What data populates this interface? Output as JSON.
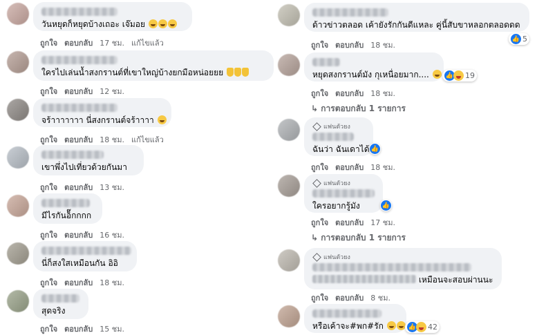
{
  "labels": {
    "like": "ถูกใจ",
    "reply": "ตอบกลับ",
    "edited": "แก้ไขแล้ว",
    "fan_badge": "แฟนตัวยง"
  },
  "left_comments": [
    {
      "text": "วันหยุดก็หยุดบ้างเถอะ เจ๊มอย",
      "time": "17 ชม.",
      "edited": true
    },
    {
      "text": "ใครไปเล่นน้ำสงกรานต์ที่เขาใหญ่บ้างยกมือหน่อยยย",
      "time": "12 ชม.",
      "edited": false
    },
    {
      "text": "จร้าาาาาาา นี่สงกรานต์จร้าาาา",
      "time": "18 ชม.",
      "edited": true
    },
    {
      "text": "เขาพึ่งไปเที่ยวด้วยกันมา",
      "time": "13 ชม.",
      "edited": false
    },
    {
      "text": "มีไรกันอ็๊กกกก",
      "time": "16 ชม.",
      "edited": false
    },
    {
      "text": "นี่ก็สงใสเหมือนกัน อิอิ",
      "time": "18 ชม.",
      "edited": false
    },
    {
      "text": "สุดจริง",
      "time": "15 ชม.",
      "edited": false
    }
  ],
  "right_comments": [
    {
      "text": "ด้าวข่าวตลอด เค้ายังรักกันดีแหละ คู่นี้สับขาหลอกตลอดดด",
      "time": "18 ชม.",
      "reaction_count": "5"
    },
    {
      "text": "หยุดสงกรานต์มัง กุเหนื่อยมาก....",
      "time": "18 ชม.",
      "reaction_count": "19",
      "replies": "การตอบกลับ 1 รายการ"
    },
    {
      "text": "ฉันว่า ฉันเดาได้",
      "time": "18 ชม."
    },
    {
      "text": "ใครอยากรู้มัง",
      "time": "17 ชม.",
      "replies": "การตอบกลับ 1 รายการ"
    },
    {
      "text": "เหมือนจะสอบผ่านนะ",
      "time": "8 ชม."
    },
    {
      "text": "หรือเค้าจะ#พก#รัก",
      "time": "18 ชม.",
      "reaction_count": "42"
    }
  ],
  "icons": {
    "like": "like-icon",
    "haha": "haha-icon",
    "reply_arrow": "reply-arrow-icon",
    "fan": "diamond-icon"
  },
  "colors": {
    "bubble": "#f0f2f5",
    "like_blue": "#1877f2",
    "meta_grey": "#65676b"
  }
}
